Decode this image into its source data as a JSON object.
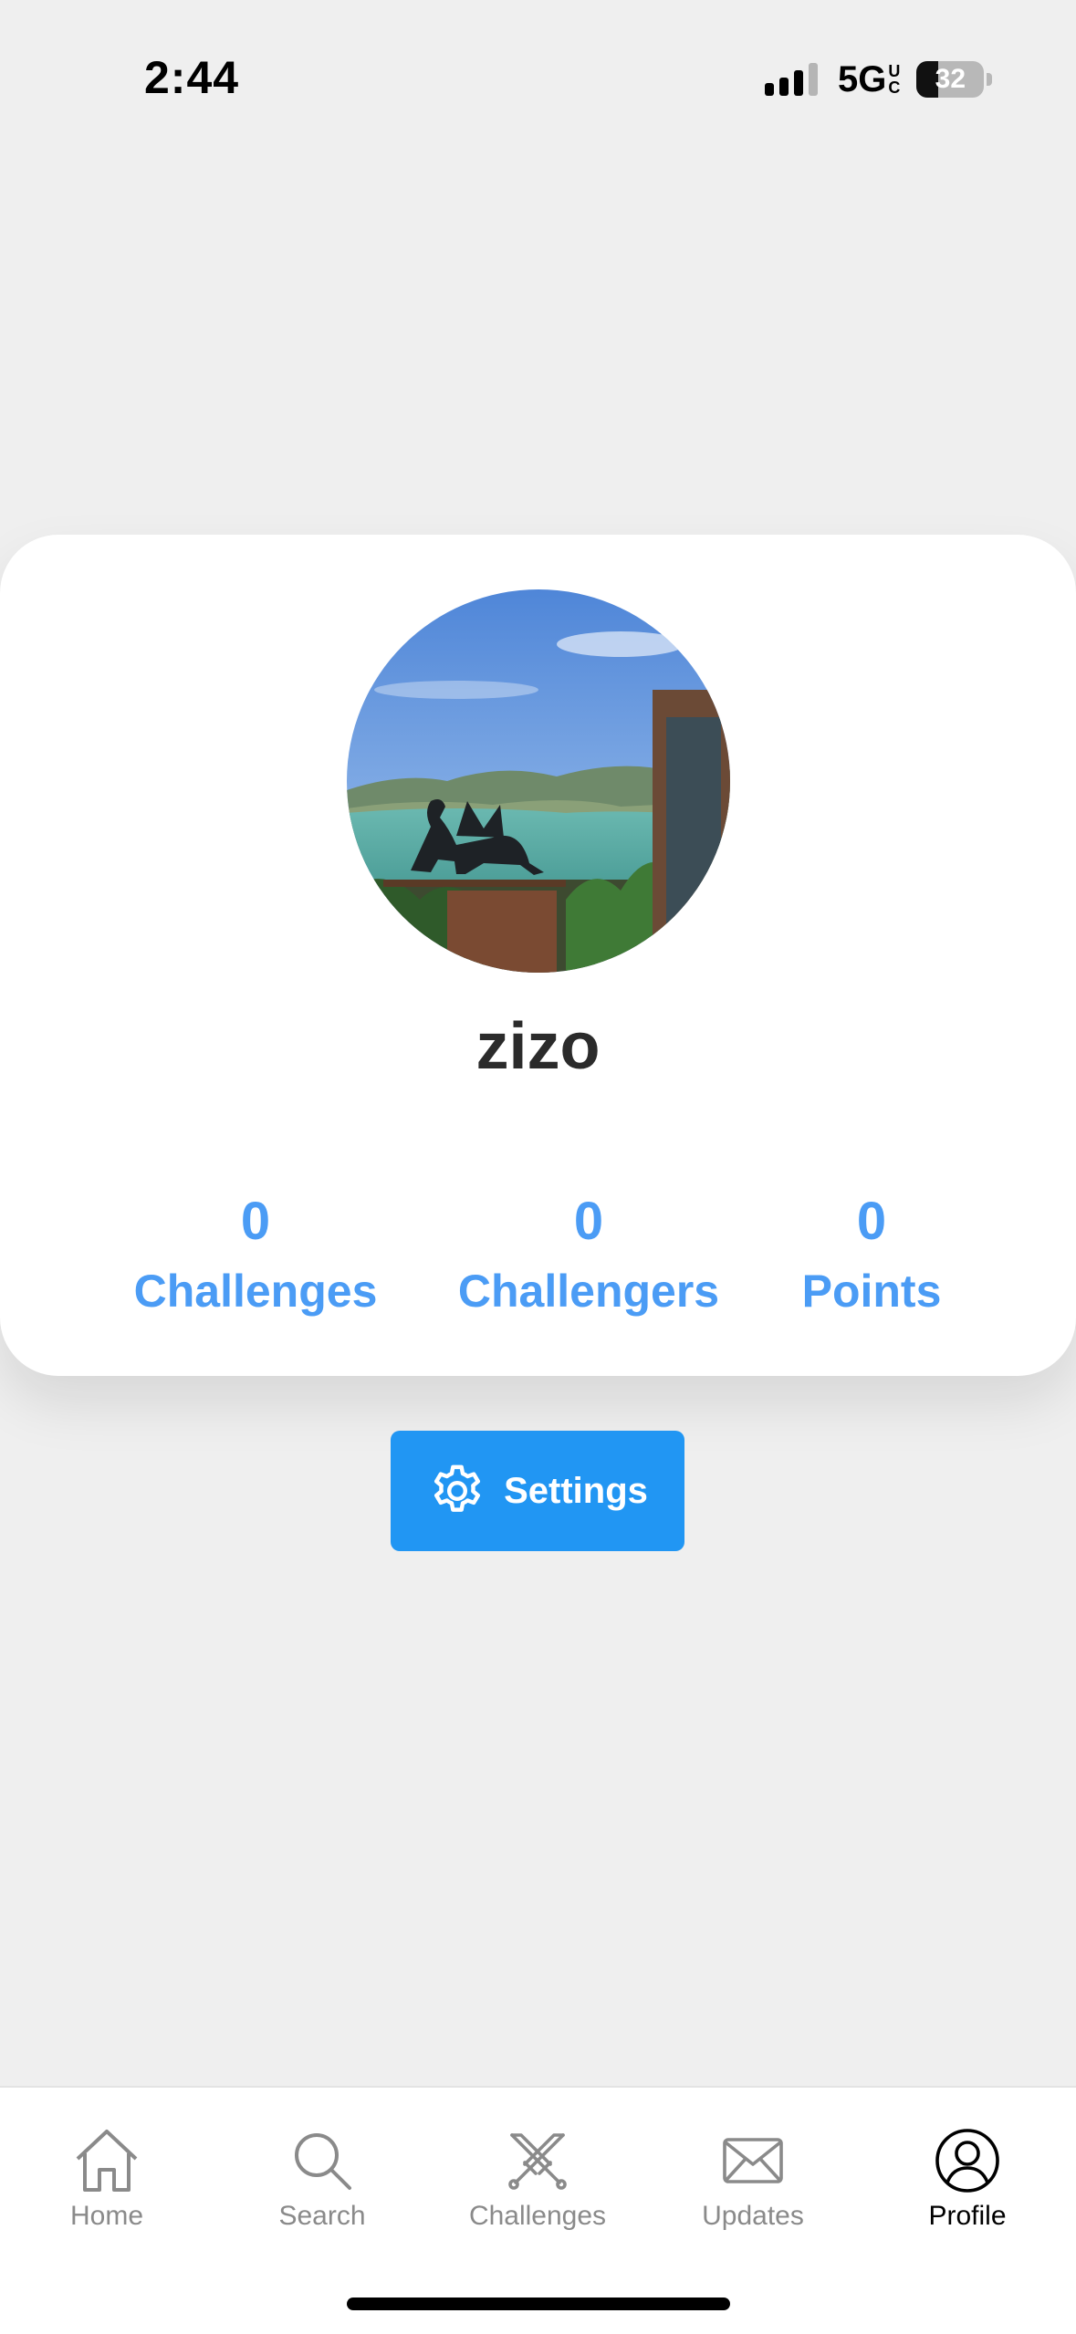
{
  "status_bar": {
    "time": "2:44",
    "network": "5G",
    "network_sub_top": "U",
    "network_sub_bottom": "C",
    "battery": "32",
    "battery_level_percent": 32
  },
  "profile": {
    "username": "zizo",
    "avatar": "profile-photo",
    "stats": [
      {
        "value": "0",
        "label": "Challenges"
      },
      {
        "value": "0",
        "label": "Challengers"
      },
      {
        "value": "0",
        "label": "Points"
      }
    ],
    "accent_color": "#4b9cf5"
  },
  "settings_button": {
    "label": "Settings",
    "icon": "gear-icon",
    "color": "#2196f3"
  },
  "tab_bar": {
    "items": [
      {
        "label": "Home",
        "icon": "home-icon"
      },
      {
        "label": "Search",
        "icon": "search-icon"
      },
      {
        "label": "Challenges",
        "icon": "crossed-swords-icon"
      },
      {
        "label": "Updates",
        "icon": "envelope-icon"
      },
      {
        "label": "Profile",
        "icon": "user-icon"
      }
    ],
    "active": "Profile"
  }
}
